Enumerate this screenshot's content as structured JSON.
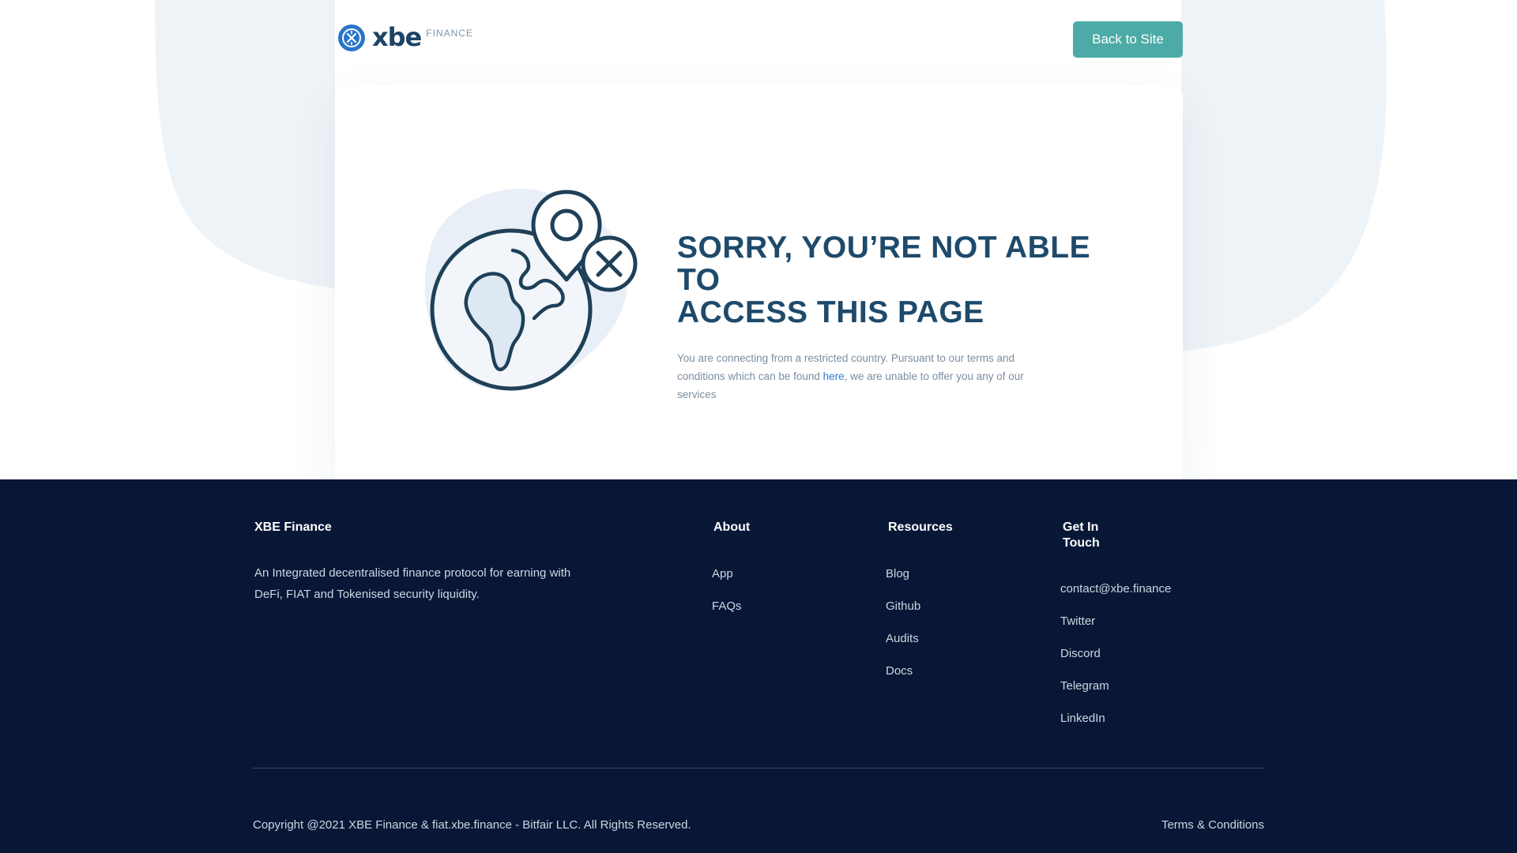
{
  "header": {
    "logo_word": "xbe",
    "logo_sub": "FINANCE",
    "back_label": "Back to Site"
  },
  "main": {
    "title_line1": "SORRY, YOU’RE NOT ABLE TO",
    "title_line2": "ACCESS THIS PAGE",
    "desc_before": "You are connecting from a restricted country. Pursuant to our terms and conditions which can be found ",
    "desc_link": "here",
    "desc_after": ", we are unable to offer you any of our services"
  },
  "footer": {
    "brand": "XBE Finance",
    "tagline": "An Integrated decentralised finance protocol for earning with DeFi, FIAT and Tokenised security liquidity.",
    "about": {
      "heading": "About",
      "items": [
        "App",
        "FAQs"
      ]
    },
    "resources": {
      "heading": "Resources",
      "items": [
        "Blog",
        "Github",
        "Audits",
        "Docs"
      ]
    },
    "contact": {
      "heading_line1": "Get In",
      "heading_line2": "Touch",
      "items": [
        "contact@xbe.finance",
        "Twitter",
        "Discord",
        "Telegram",
        "LinkedIn"
      ]
    },
    "copyright": "Copyright @2021 XBE Finance & fiat.xbe.finance - Bitfair LLC. All Rights Reserved.",
    "terms": "Terms & Conditions"
  },
  "colors": {
    "accent": "#4caba7",
    "navy": "#081736",
    "title": "#1e4a6b",
    "link": "#2f7dd3",
    "blob": "#eef3f7"
  },
  "icons": [
    "xbe-logo-icon",
    "globe-location-blocked-icon"
  ]
}
